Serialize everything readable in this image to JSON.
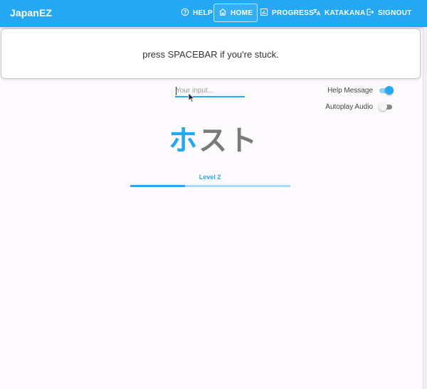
{
  "app": {
    "brand": "JapanEZ"
  },
  "nav": {
    "items": [
      {
        "label": "HELP",
        "icon": "help-circle-icon"
      },
      {
        "label": "HOME",
        "icon": "home-icon",
        "active": true
      },
      {
        "label": "PROGRESS",
        "icon": "chart-icon"
      },
      {
        "label": "KATAKANA",
        "icon": "translate-icon"
      },
      {
        "label": "SIGNOUT",
        "icon": "signout-icon"
      }
    ]
  },
  "message": {
    "text": "press SPACEBAR if you're stuck."
  },
  "input": {
    "value": "",
    "placeholder": "Your input..."
  },
  "settings": {
    "help_message": {
      "label": "Help Message",
      "on": true
    },
    "autoplay_audio": {
      "label": "Autoplay Audio",
      "on": false
    }
  },
  "prompt": {
    "typed": "ホ",
    "remaining": "スト"
  },
  "level": {
    "label": "Level 2",
    "progress": 0.34
  },
  "colors": {
    "accent": "#24a8f2",
    "accent_light": "#a6dbfa",
    "pending_kana": "#7a7a7a"
  }
}
